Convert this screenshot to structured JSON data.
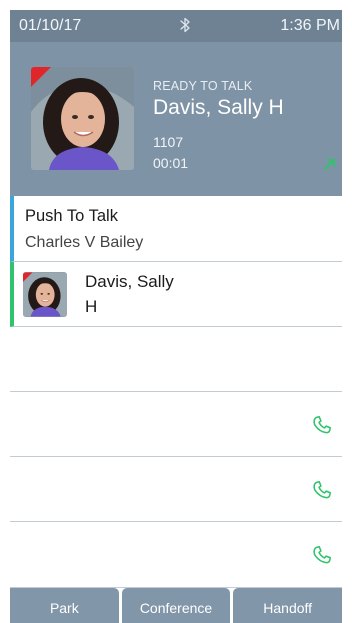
{
  "status_bar": {
    "date": "01/10/17",
    "time": "1:36 PM",
    "icon": "bluetooth-icon"
  },
  "call": {
    "status": "READY TO TALK",
    "name": "Davis, Sally H",
    "extension": "1107",
    "timer": "00:01",
    "direction_icon": "outgoing-arrow-icon"
  },
  "list": {
    "ptt": {
      "title": "Push To Talk",
      "subtitle": "Charles V Bailey"
    },
    "contact": {
      "name": "Davis, Sally H"
    },
    "empty_rows": [
      {
        "icon": "phone-icon"
      },
      {
        "icon": "phone-icon"
      },
      {
        "icon": "phone-icon"
      },
      {
        "icon": "phone-icon"
      }
    ]
  },
  "softkeys": [
    {
      "label": "Park"
    },
    {
      "label": "Conference"
    },
    {
      "label": "Handoff"
    }
  ],
  "colors": {
    "header": "#7f93a6",
    "status_bar": "#6e8294",
    "ptt_accent": "#3aa6dc",
    "contact_accent": "#2fc36b",
    "phone_green": "#2fc36b",
    "softkey": "#8196a9"
  }
}
